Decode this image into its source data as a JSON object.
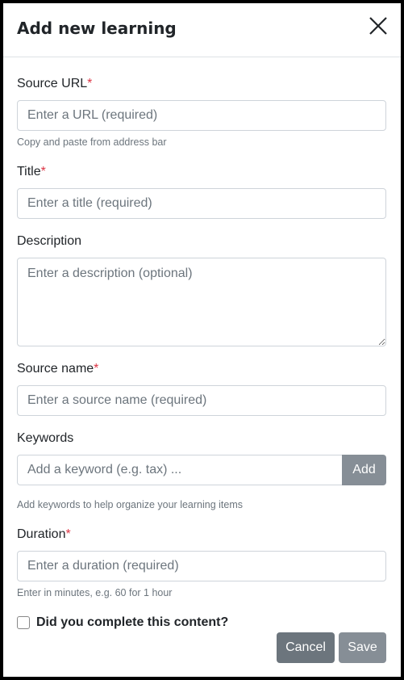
{
  "modal": {
    "title": "Add new learning"
  },
  "fields": {
    "source_url": {
      "label": "Source URL",
      "required": "*",
      "placeholder": "Enter a URL (required)",
      "help": "Copy and paste from address bar"
    },
    "title": {
      "label": "Title",
      "required": "*",
      "placeholder": "Enter a title (required)"
    },
    "description": {
      "label": "Description",
      "placeholder": "Enter a description (optional)"
    },
    "source_name": {
      "label": "Source name",
      "required": "*",
      "placeholder": "Enter a source name (required)"
    },
    "keywords": {
      "label": "Keywords",
      "placeholder": "Add a keyword (e.g. tax) ...",
      "add_label": "Add",
      "help": "Add keywords to help organize your learning items"
    },
    "duration": {
      "label": "Duration",
      "required": "*",
      "placeholder": "Enter a duration (required)",
      "help": "Enter in minutes, e.g. 60 for 1 hour"
    }
  },
  "completed": {
    "label": "Did you complete this content?"
  },
  "actions": {
    "cancel": "Cancel",
    "save": "Save"
  },
  "icons": {
    "close": "close-icon"
  }
}
